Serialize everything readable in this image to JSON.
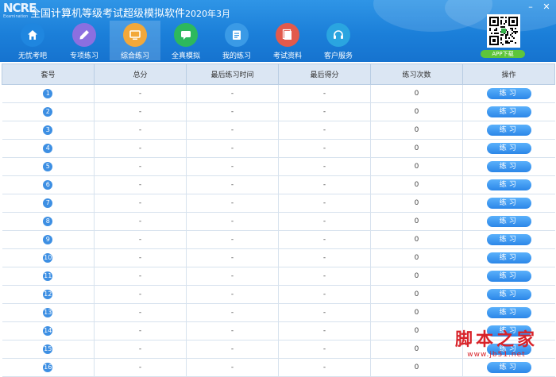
{
  "header": {
    "logo_main": "NCRE",
    "logo_sub": "Examination",
    "title": "全国计算机等级考试超级模拟软件",
    "version": "2020年3月",
    "app_download": "APP下载"
  },
  "nav": [
    {
      "label": "无忧考吧",
      "icon": "home-icon",
      "color": "#1f86df"
    },
    {
      "label": "专项练习",
      "icon": "pencil-icon",
      "color": "#8b6fe0"
    },
    {
      "label": "综合练习",
      "icon": "monitor-icon",
      "color": "#f2a83a"
    },
    {
      "label": "全真模拟",
      "icon": "chat-icon",
      "color": "#2db85d"
    },
    {
      "label": "我的练习",
      "icon": "clipboard-icon",
      "color": "#3a9ae6"
    },
    {
      "label": "考试资料",
      "icon": "document-icon",
      "color": "#e25a4c"
    },
    {
      "label": "客户服务",
      "icon": "headset-icon",
      "color": "#2aa5e0"
    }
  ],
  "table": {
    "headers": [
      "套号",
      "总分",
      "最后练习时间",
      "最后得分",
      "练习次数",
      "操作"
    ],
    "rows": [
      {
        "no": "1",
        "total": "-",
        "time": "-",
        "score": "-",
        "count": "0",
        "action": "练习"
      },
      {
        "no": "2",
        "total": "-",
        "time": "-",
        "score": "-",
        "count": "0",
        "action": "练习"
      },
      {
        "no": "3",
        "total": "-",
        "time": "-",
        "score": "-",
        "count": "0",
        "action": "练习"
      },
      {
        "no": "4",
        "total": "-",
        "time": "-",
        "score": "-",
        "count": "0",
        "action": "练习"
      },
      {
        "no": "5",
        "total": "-",
        "time": "-",
        "score": "-",
        "count": "0",
        "action": "练习"
      },
      {
        "no": "6",
        "total": "-",
        "time": "-",
        "score": "-",
        "count": "0",
        "action": "练习"
      },
      {
        "no": "7",
        "total": "-",
        "time": "-",
        "score": "-",
        "count": "0",
        "action": "练习"
      },
      {
        "no": "8",
        "total": "-",
        "time": "-",
        "score": "-",
        "count": "0",
        "action": "练习"
      },
      {
        "no": "9",
        "total": "-",
        "time": "-",
        "score": "-",
        "count": "0",
        "action": "练习"
      },
      {
        "no": "10",
        "total": "-",
        "time": "-",
        "score": "-",
        "count": "0",
        "action": "练习"
      },
      {
        "no": "11",
        "total": "-",
        "time": "-",
        "score": "-",
        "count": "0",
        "action": "练习"
      },
      {
        "no": "12",
        "total": "-",
        "time": "-",
        "score": "-",
        "count": "0",
        "action": "练习"
      },
      {
        "no": "13",
        "total": "-",
        "time": "-",
        "score": "-",
        "count": "0",
        "action": "练习"
      },
      {
        "no": "14",
        "total": "-",
        "time": "-",
        "score": "-",
        "count": "0",
        "action": "练习"
      },
      {
        "no": "15",
        "total": "-",
        "time": "-",
        "score": "-",
        "count": "0",
        "action": "练习"
      },
      {
        "no": "16",
        "total": "-",
        "time": "-",
        "score": "-",
        "count": "0",
        "action": "练习"
      }
    ]
  },
  "watermark": {
    "main": "脚本之家",
    "url": "www.jb51.net"
  }
}
